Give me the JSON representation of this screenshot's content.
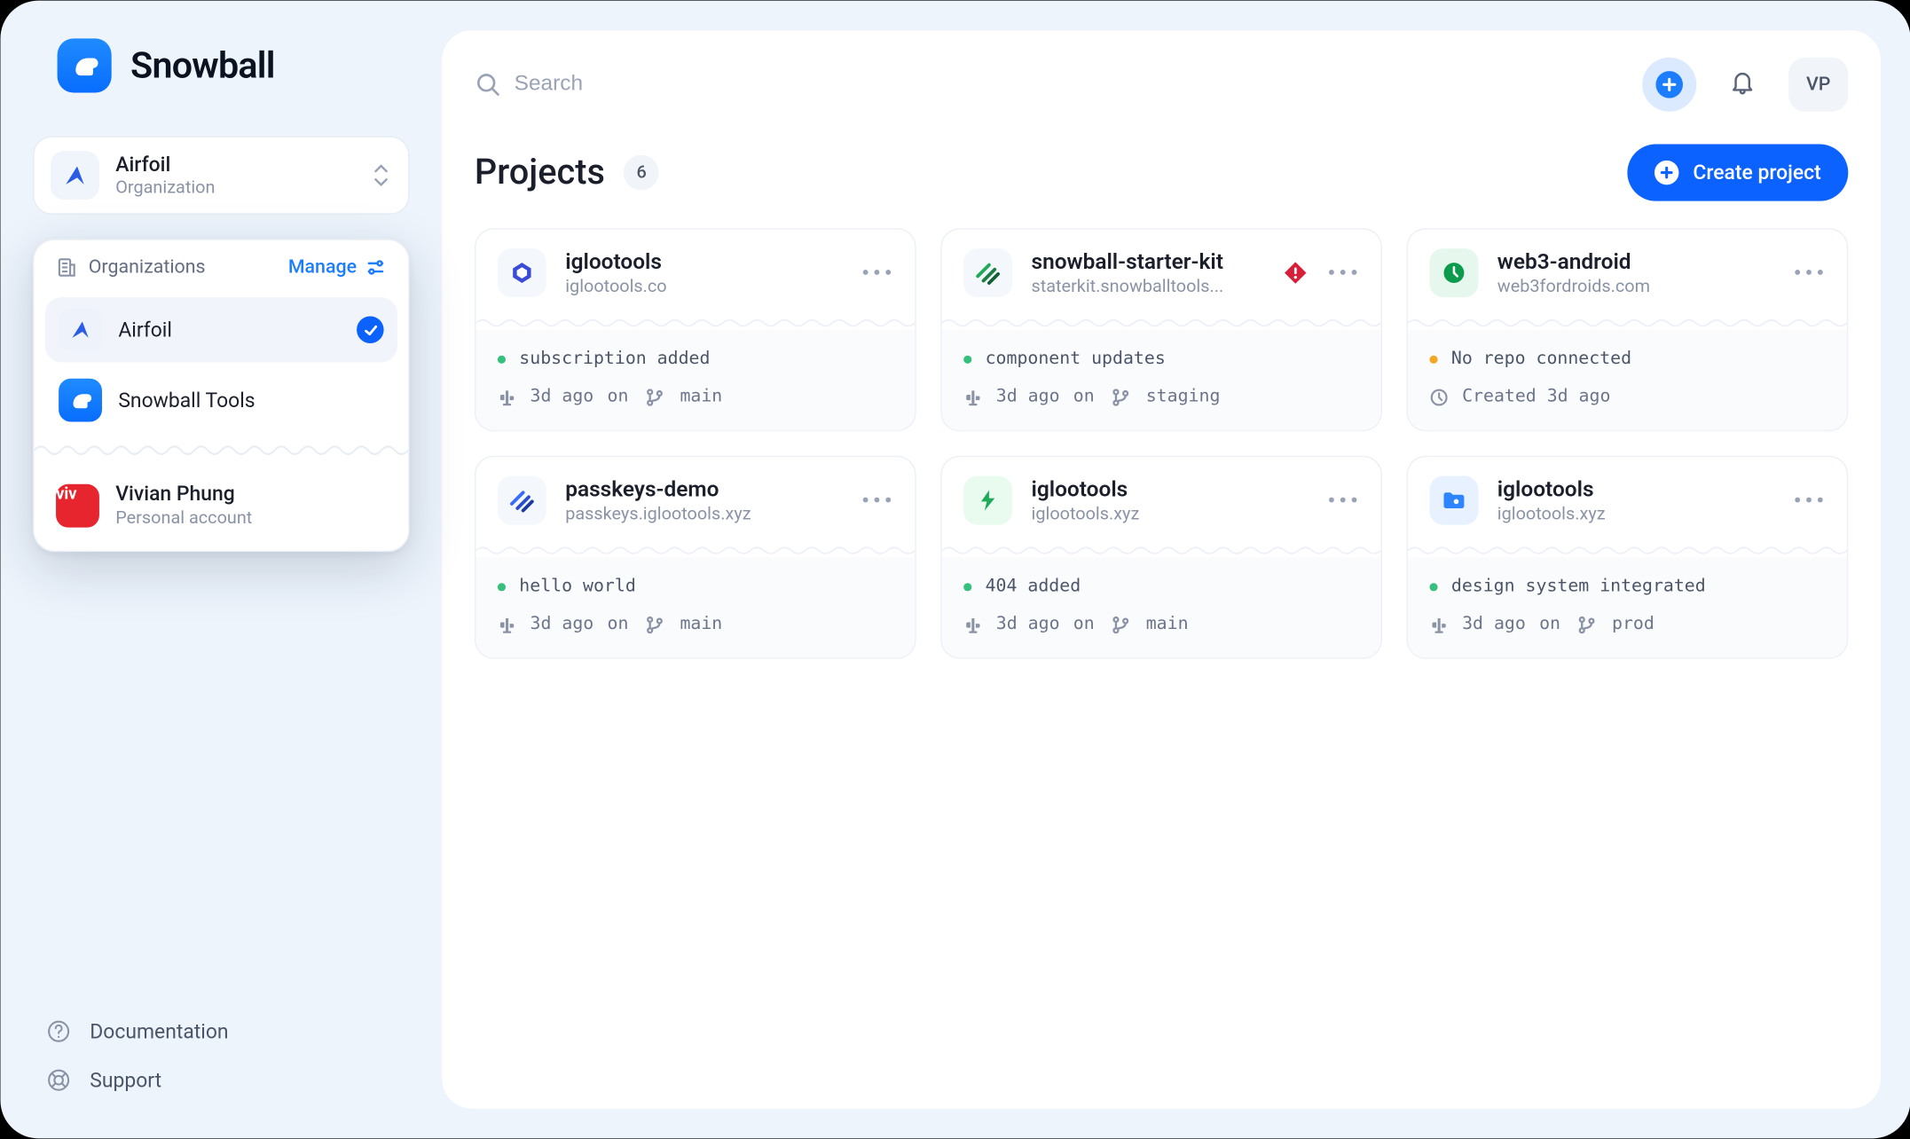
{
  "app": {
    "name": "Snowball"
  },
  "search": {
    "placeholder": "Search"
  },
  "user": {
    "initials": "VP"
  },
  "org_switcher": {
    "name": "Airfoil",
    "subtitle": "Organization"
  },
  "org_panel": {
    "header_label": "Organizations",
    "manage_label": "Manage",
    "orgs": [
      {
        "name": "Airfoil",
        "selected": true
      },
      {
        "name": "Snowball Tools",
        "selected": false
      }
    ],
    "personal": {
      "name": "Vivian Phung",
      "subtitle": "Personal account",
      "avatar_text": "viv"
    }
  },
  "sidebar_links": {
    "documentation": "Documentation",
    "support": "Support"
  },
  "page": {
    "title": "Projects",
    "count": "6",
    "create_label": "Create project"
  },
  "projects": [
    {
      "name": "iglootools",
      "domain": "iglootools.co",
      "commit_msg": "subscription added",
      "status": "ok",
      "timestamp": "3d ago",
      "on_word": "on",
      "branch": "main",
      "icon": "hexagon-blue",
      "warning": false,
      "meta_kind": "branch"
    },
    {
      "name": "snowball-starter-kit",
      "domain": "staterkit.snowballtools...",
      "commit_msg": "component updates",
      "status": "ok",
      "timestamp": "3d ago",
      "on_word": "on",
      "branch": "staging",
      "icon": "stripes-green",
      "warning": true,
      "meta_kind": "branch"
    },
    {
      "name": "web3-android",
      "domain": "web3fordroids.com",
      "commit_msg": "No repo connected",
      "status": "warn",
      "timestamp": "Created 3d ago",
      "on_word": "",
      "branch": "",
      "icon": "circle-green",
      "warning": false,
      "meta_kind": "created"
    },
    {
      "name": "passkeys-demo",
      "domain": "passkeys.iglootools.xyz",
      "commit_msg": "hello world",
      "status": "ok",
      "timestamp": "3d ago",
      "on_word": "on",
      "branch": "main",
      "icon": "stripes-blue",
      "warning": false,
      "meta_kind": "branch"
    },
    {
      "name": "iglootools",
      "domain": "iglootools.xyz",
      "commit_msg": "404 added",
      "status": "ok",
      "timestamp": "3d ago",
      "on_word": "on",
      "branch": "main",
      "icon": "bolt-green",
      "warning": false,
      "meta_kind": "branch"
    },
    {
      "name": "iglootools",
      "domain": "iglootools.xyz",
      "commit_msg": "design system integrated",
      "status": "ok",
      "timestamp": "3d ago",
      "on_word": "on",
      "branch": "prod",
      "icon": "folder-blue",
      "warning": false,
      "meta_kind": "branch"
    }
  ]
}
